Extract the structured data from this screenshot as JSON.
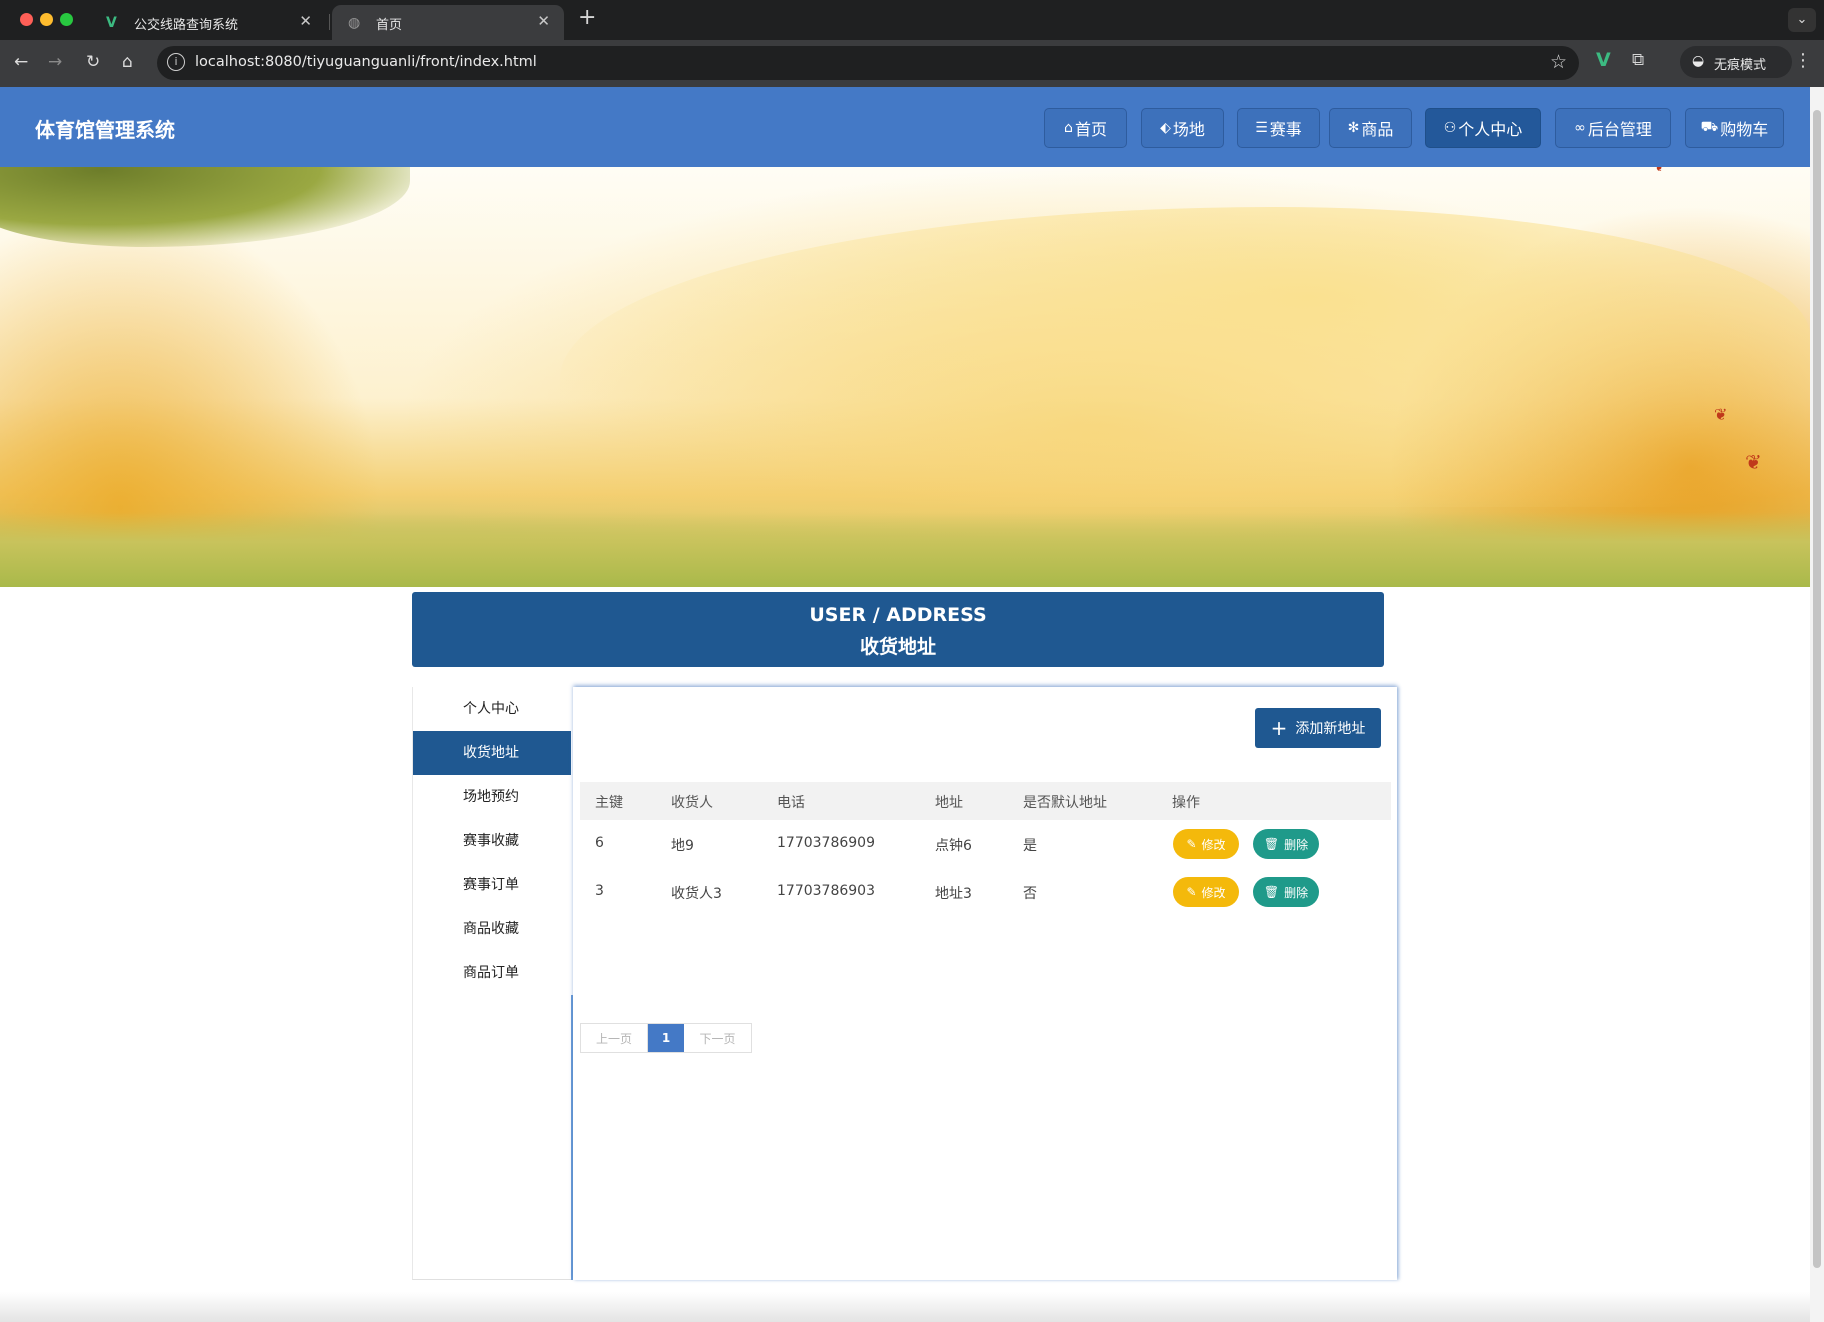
{
  "browser": {
    "tabs": [
      {
        "title": "公交线路查询系统",
        "icon": "vue-icon"
      },
      {
        "title": "首页",
        "icon": "globe-icon"
      }
    ],
    "new_tab": "+",
    "url": "localhost:8080/tiyuguanguanli/front/index.html",
    "incognito_label": "无痕模式"
  },
  "header": {
    "brand": "体育馆管理系统",
    "nav": [
      {
        "label": "首页",
        "icon": "home-icon",
        "glyph": "⌂"
      },
      {
        "label": "场地",
        "icon": "tag-icon",
        "glyph": "⬖"
      },
      {
        "label": "赛事",
        "icon": "sliders-icon",
        "glyph": "☰"
      },
      {
        "label": "商品",
        "icon": "snowflake-icon",
        "glyph": "✻"
      },
      {
        "label": "个人中心",
        "icon": "user-icon",
        "glyph": "⚇"
      },
      {
        "label": "后台管理",
        "icon": "link-icon",
        "glyph": "∞"
      },
      {
        "label": "购物车",
        "icon": "cart-icon",
        "glyph": "⛟"
      }
    ],
    "active_nav": "个人中心"
  },
  "banner": {
    "slides": 3,
    "active_slide": 1
  },
  "page_title": {
    "en": "USER / ADDRESS",
    "zh": "收货地址"
  },
  "sidebar": {
    "items": [
      "个人中心",
      "收货地址",
      "场地预约",
      "赛事收藏",
      "赛事订单",
      "商品收藏",
      "商品订单"
    ],
    "active": "收货地址"
  },
  "content": {
    "add_button": "添加新地址",
    "table": {
      "headers": [
        "主键",
        "收货人",
        "电话",
        "地址",
        "是否默认地址",
        "操作"
      ],
      "rows": [
        {
          "id": "6",
          "name": "地9",
          "phone": "17703786909",
          "address": "点钟6",
          "default": "是"
        },
        {
          "id": "3",
          "name": "收货人3",
          "phone": "17703786903",
          "address": "地址3",
          "default": "否"
        }
      ],
      "edit_label": "修改",
      "delete_label": "删除"
    },
    "pagination": {
      "prev": "上一页",
      "current": "1",
      "next": "下一页"
    }
  },
  "colors": {
    "header_blue": "#4479c6",
    "dark_blue": "#1f5891",
    "edit_yellow": "#f4b90b",
    "delete_teal": "#1f9a8a"
  }
}
